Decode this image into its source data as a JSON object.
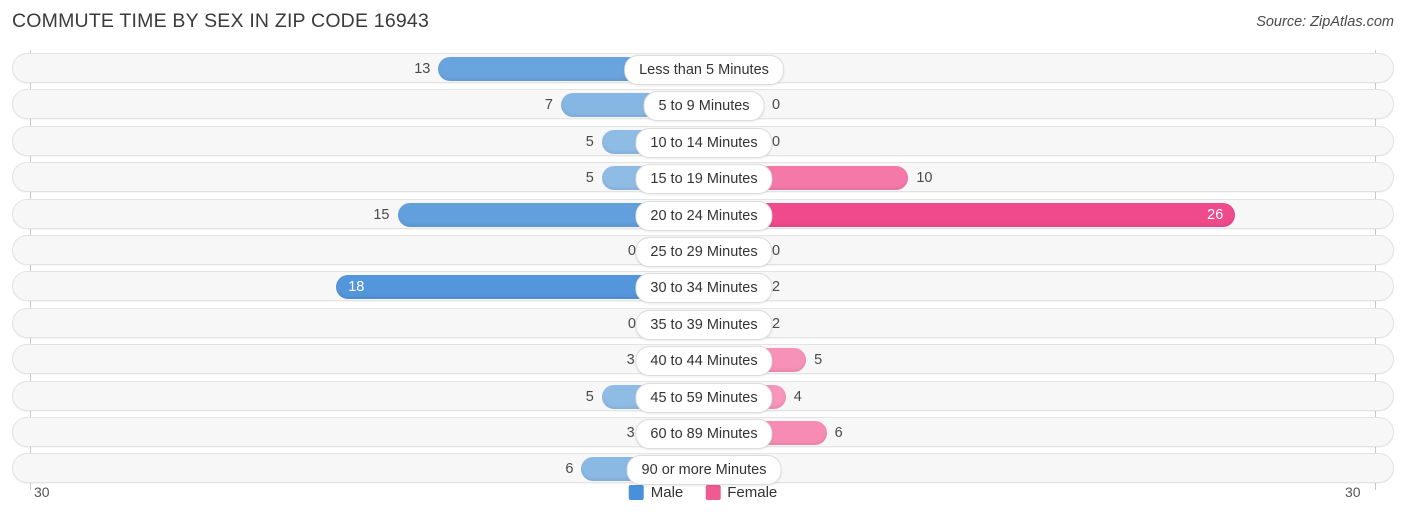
{
  "header": {
    "title": "COMMUTE TIME BY SEX IN ZIP CODE 16943",
    "source": "Source: ZipAtlas.com"
  },
  "axis": {
    "left_tick": "30",
    "right_tick": "30"
  },
  "legend": {
    "items": [
      {
        "label": "Male",
        "color": "#4a90d9"
      },
      {
        "label": "Female",
        "color": "#ef5a92"
      }
    ]
  },
  "chart_data": {
    "type": "bar",
    "orientation": "horizontal-diverging",
    "title": "COMMUTE TIME BY SEX IN ZIP CODE 16943",
    "xlabel": "",
    "ylabel": "",
    "xlim": [
      30,
      30
    ],
    "grid": false,
    "legend_position": "bottom-center",
    "categories": [
      "Less than 5 Minutes",
      "5 to 9 Minutes",
      "10 to 14 Minutes",
      "15 to 19 Minutes",
      "20 to 24 Minutes",
      "25 to 29 Minutes",
      "30 to 34 Minutes",
      "35 to 39 Minutes",
      "40 to 44 Minutes",
      "45 to 59 Minutes",
      "60 to 89 Minutes",
      "90 or more Minutes"
    ],
    "series": [
      {
        "name": "Male",
        "values": [
          13,
          7,
          5,
          5,
          15,
          0,
          18,
          0,
          3,
          5,
          3,
          6
        ]
      },
      {
        "name": "Female",
        "values": [
          0,
          0,
          0,
          10,
          26,
          0,
          2,
          2,
          5,
          4,
          6,
          0
        ]
      }
    ],
    "value_labels": {
      "Male": [
        "13",
        "7",
        "5",
        "5",
        "15",
        "0",
        "18",
        "0",
        "3",
        "5",
        "3",
        "6"
      ],
      "Female": [
        "0",
        "0",
        "0",
        "10",
        "26",
        "0",
        "2",
        "2",
        "5",
        "4",
        "6",
        "0"
      ]
    }
  }
}
